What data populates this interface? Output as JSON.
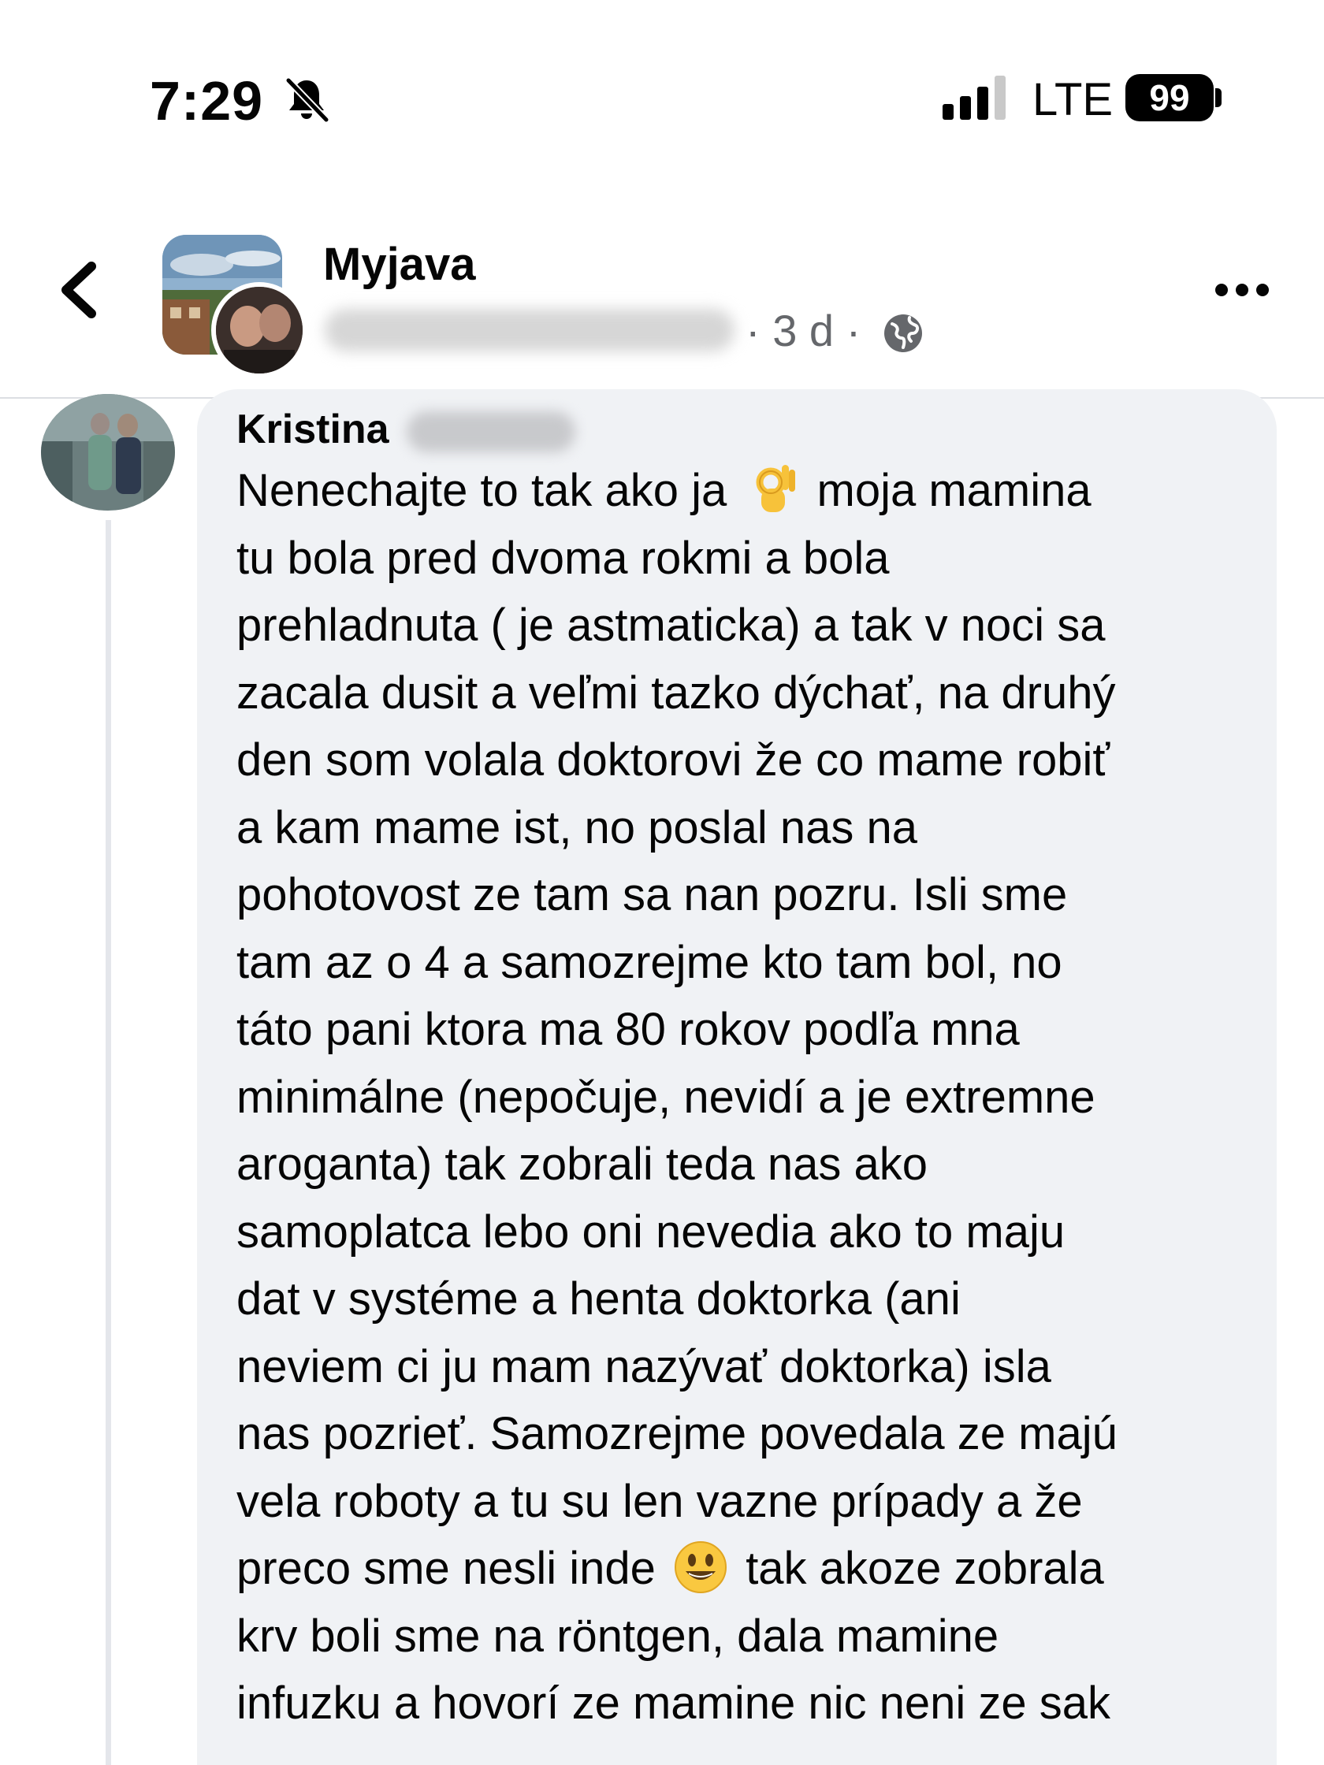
{
  "status_bar": {
    "time": "7:29",
    "network": "LTE",
    "battery": "99",
    "icons": [
      "bell-slash-icon",
      "signal-bars-icon"
    ]
  },
  "header": {
    "back_icon": "chevron-left-icon",
    "group_name": "Myjava",
    "post_meta": "· 3 d ·",
    "privacy_icon": "globe-icon",
    "more_icon": "more-horizontal-icon"
  },
  "comment": {
    "author": "Kristina",
    "lines": [
      [
        "Nenechajte to tak ako ja ",
        "moja mamina"
      ],
      "tu bola pred dvoma rokmi  a bola",
      "prehladnuta ( je astmaticka) a tak v noci sa",
      "zacala dusit a veľmi tazko dýchať, na druhý",
      "den som volala doktorovi že co mame robiť",
      "a kam mame ist, no poslal nas na",
      "pohotovost ze tam sa nan pozru. Isli sme",
      "tam az o 4 a samozrejme kto tam bol, no",
      "táto pani ktora ma 80 rokov podľa mna",
      "minimálne (nepočuje, nevidí a je extremne",
      "aroganta) tak zobrali teda nas ako",
      "samoplatca lebo oni nevedia ako to maju",
      "dat  v systéme a henta doktorka (ani",
      "neviem ci ju mam nazývať doktorka) isla",
      "nas pozrieť. Samozrejme povedala ze majú",
      "vela roboty a tu su len vazne prípady a že",
      [
        "preco sme nesli inde ",
        "tak akoze zobrala"
      ],
      "krv boli sme na röntgen, dala mamine",
      "infuzku a hovorí ze mamine nic neni ze sak"
    ],
    "emojis": [
      "ok-hand-emoji",
      "smiley-emoji"
    ]
  },
  "colors": {
    "bubble": "#f0f2f5",
    "meta_text": "#65676b",
    "divider": "#dcdee3"
  }
}
